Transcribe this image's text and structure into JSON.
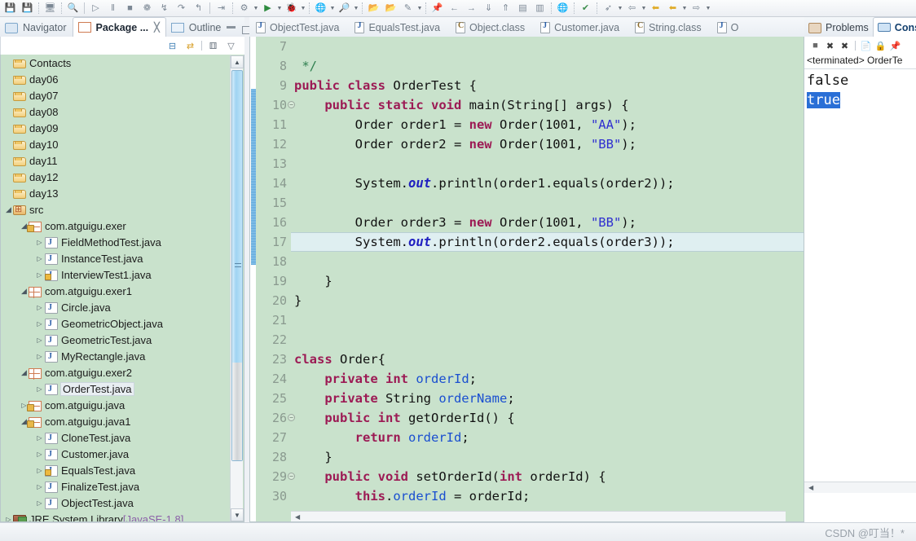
{
  "toolbar": {
    "icons": [
      {
        "name": "save-icon",
        "glyph": "💾"
      },
      {
        "name": "save-all-icon",
        "glyph": "💾"
      },
      {
        "name": "print-icon",
        "glyph": "🖵"
      },
      {
        "name": "search-icon",
        "glyph": "🔍"
      },
      {
        "name": "run-last-tool-icon",
        "glyph": "▷"
      },
      {
        "name": "pause-icon",
        "glyph": "‖"
      },
      {
        "name": "terminate-icon",
        "glyph": "■"
      },
      {
        "name": "disconnect-icon",
        "glyph": "✁"
      },
      {
        "name": "step-into-icon",
        "glyph": "↓"
      },
      {
        "name": "step-over-icon",
        "glyph": "↷"
      },
      {
        "name": "step-return-icon",
        "glyph": "↰"
      },
      {
        "name": "skip-breakpoints-icon",
        "glyph": "⇥"
      },
      {
        "name": "new-java-project-icon",
        "glyph": "⚙"
      },
      {
        "name": "run-icon",
        "glyph": "▶"
      },
      {
        "name": "debug-icon",
        "glyph": "🐞"
      },
      {
        "name": "run-external-tools-icon",
        "glyph": "🌐"
      },
      {
        "name": "search-java-icon",
        "glyph": "🔎"
      },
      {
        "name": "open-type-icon",
        "glyph": "📂"
      },
      {
        "name": "open-task-icon",
        "glyph": "📂"
      },
      {
        "name": "new-editor-icon",
        "glyph": "✎"
      },
      {
        "name": "pin-editor-icon",
        "glyph": "📌"
      },
      {
        "name": "back-icon",
        "glyph": "←"
      },
      {
        "name": "forward-icon",
        "glyph": "→"
      },
      {
        "name": "next-annotation-icon",
        "glyph": "⤓"
      },
      {
        "name": "prev-annotation-icon",
        "glyph": "⤒"
      },
      {
        "name": "toggle-mark-icon",
        "glyph": "▤"
      },
      {
        "name": "toggle-block-icon",
        "glyph": "▥"
      },
      {
        "name": "open-perspective-icon",
        "glyph": "🌐"
      },
      {
        "name": "show-view-icon",
        "glyph": "✔"
      },
      {
        "name": "last-edit-icon",
        "glyph": "➦"
      },
      {
        "name": "back-history-icon",
        "glyph": "⇦"
      },
      {
        "name": "forward-history-icon",
        "glyph": "⇨"
      },
      {
        "name": "next-nav-icon",
        "glyph": "⇨"
      }
    ]
  },
  "left_pane": {
    "tabs": [
      {
        "label": "Navigator",
        "active": false,
        "icon": "navigator-icon"
      },
      {
        "label": "Package ...",
        "active": true,
        "icon": "package-explorer-icon",
        "close": "╳"
      },
      {
        "label": "Outline",
        "active": false,
        "icon": "outline-icon"
      }
    ],
    "view_buttons": [
      {
        "name": "minimize-view-button",
        "glyph": "▁"
      },
      {
        "name": "maximize-view-button",
        "glyph": "□"
      }
    ],
    "local_toolbar": [
      {
        "name": "collapse-all-icon",
        "glyph": "⊟"
      },
      {
        "name": "link-with-editor-icon",
        "glyph": "⇄"
      },
      {
        "name": "view-menu-icon",
        "glyph": "▽"
      }
    ],
    "tree": [
      {
        "label": "Contacts",
        "indent": 0,
        "arrow": "none",
        "icon": "ic-folder",
        "selected": false
      },
      {
        "label": "day06",
        "indent": 0,
        "arrow": "none",
        "icon": "ic-folder",
        "selected": false
      },
      {
        "label": "day07",
        "indent": 0,
        "arrow": "none",
        "icon": "ic-folder",
        "selected": false
      },
      {
        "label": "day08",
        "indent": 0,
        "arrow": "none",
        "icon": "ic-folder",
        "selected": false
      },
      {
        "label": "day09",
        "indent": 0,
        "arrow": "none",
        "icon": "ic-folder",
        "selected": false
      },
      {
        "label": "day10",
        "indent": 0,
        "arrow": "none",
        "icon": "ic-folder",
        "selected": false
      },
      {
        "label": "day11",
        "indent": 0,
        "arrow": "none",
        "icon": "ic-folder",
        "selected": false
      },
      {
        "label": "day12",
        "indent": 0,
        "arrow": "none",
        "icon": "ic-folder",
        "selected": false
      },
      {
        "label": "day13",
        "indent": 0,
        "arrow": "none",
        "icon": "ic-folder",
        "selected": false
      },
      {
        "label": "src",
        "indent": 0,
        "arrow": "open",
        "icon": "ic-src",
        "selected": false
      },
      {
        "label": "com.atguigu.exer",
        "indent": 1,
        "arrow": "open",
        "icon": "ic-pkgl",
        "selected": false
      },
      {
        "label": "FieldMethodTest.java",
        "indent": 2,
        "arrow": "closed",
        "icon": "ic-java",
        "selected": false
      },
      {
        "label": "InstanceTest.java",
        "indent": 2,
        "arrow": "closed",
        "icon": "ic-java",
        "selected": false
      },
      {
        "label": "InterviewTest1.java",
        "indent": 2,
        "arrow": "closed",
        "icon": "ic-javal",
        "selected": false
      },
      {
        "label": "com.atguigu.exer1",
        "indent": 1,
        "arrow": "open",
        "icon": "ic-pkg",
        "selected": false
      },
      {
        "label": "Circle.java",
        "indent": 2,
        "arrow": "closed",
        "icon": "ic-java",
        "selected": false
      },
      {
        "label": "GeometricObject.java",
        "indent": 2,
        "arrow": "closed",
        "icon": "ic-java",
        "selected": false
      },
      {
        "label": "GeometricTest.java",
        "indent": 2,
        "arrow": "closed",
        "icon": "ic-java",
        "selected": false
      },
      {
        "label": "MyRectangle.java",
        "indent": 2,
        "arrow": "closed",
        "icon": "ic-java",
        "selected": false
      },
      {
        "label": "com.atguigu.exer2",
        "indent": 1,
        "arrow": "open",
        "icon": "ic-pkg",
        "selected": false
      },
      {
        "label": "OrderTest.java",
        "indent": 2,
        "arrow": "closed",
        "icon": "ic-java",
        "selected": true
      },
      {
        "label": "com.atguigu.java",
        "indent": 1,
        "arrow": "closed",
        "icon": "ic-pkgl",
        "selected": false
      },
      {
        "label": "com.atguigu.java1",
        "indent": 1,
        "arrow": "open",
        "icon": "ic-pkgl",
        "selected": false
      },
      {
        "label": "CloneTest.java",
        "indent": 2,
        "arrow": "closed",
        "icon": "ic-java",
        "selected": false
      },
      {
        "label": "Customer.java",
        "indent": 2,
        "arrow": "closed",
        "icon": "ic-java",
        "selected": false
      },
      {
        "label": "EqualsTest.java",
        "indent": 2,
        "arrow": "closed",
        "icon": "ic-javal",
        "selected": false
      },
      {
        "label": "FinalizeTest.java",
        "indent": 2,
        "arrow": "closed",
        "icon": "ic-java",
        "selected": false
      },
      {
        "label": "ObjectTest.java",
        "indent": 2,
        "arrow": "closed",
        "icon": "ic-java",
        "selected": false
      },
      {
        "label": "JRE System Library",
        "indent": 0,
        "arrow": "closed",
        "icon": "ic-jre",
        "selected": false,
        "suffix": " [JavaSE-1.8]"
      }
    ]
  },
  "editor": {
    "tabs": [
      {
        "label": "ObjectTest.java",
        "icon": "java-file-icon"
      },
      {
        "label": "EqualsTest.java",
        "icon": "java-file-lock-icon"
      },
      {
        "label": "Object.class",
        "icon": "class-file-icon"
      },
      {
        "label": "Customer.java",
        "icon": "java-file-icon"
      },
      {
        "label": "String.class",
        "icon": "class-file-icon"
      },
      {
        "label": "O",
        "icon": "java-file-icon"
      }
    ],
    "first_line_number": 7,
    "highlighted_line": 17,
    "fold_lines": [
      10,
      26,
      29
    ],
    "lines": [
      {
        "n": 7,
        "tokens": []
      },
      {
        "n": 8,
        "tokens": [
          {
            "t": " */",
            "c": "cmt"
          }
        ]
      },
      {
        "n": 9,
        "tokens": [
          {
            "t": "public",
            "c": "kw"
          },
          {
            "t": " ",
            "c": "plain"
          },
          {
            "t": "class",
            "c": "kw"
          },
          {
            "t": " OrderTest {",
            "c": "plain"
          }
        ]
      },
      {
        "n": 10,
        "tokens": [
          {
            "t": "    ",
            "c": "plain"
          },
          {
            "t": "public",
            "c": "kw"
          },
          {
            "t": " ",
            "c": "plain"
          },
          {
            "t": "static",
            "c": "kw"
          },
          {
            "t": " ",
            "c": "plain"
          },
          {
            "t": "void",
            "c": "kw"
          },
          {
            "t": " main(String[] args) {",
            "c": "plain"
          }
        ]
      },
      {
        "n": 11,
        "tokens": [
          {
            "t": "        Order order1 = ",
            "c": "plain"
          },
          {
            "t": "new",
            "c": "kw"
          },
          {
            "t": " Order(1001, ",
            "c": "plain"
          },
          {
            "t": "\"AA\"",
            "c": "str"
          },
          {
            "t": ");",
            "c": "plain"
          }
        ]
      },
      {
        "n": 12,
        "tokens": [
          {
            "t": "        Order order2 = ",
            "c": "plain"
          },
          {
            "t": "new",
            "c": "kw"
          },
          {
            "t": " Order(1001, ",
            "c": "plain"
          },
          {
            "t": "\"BB\"",
            "c": "str"
          },
          {
            "t": ");",
            "c": "plain"
          }
        ]
      },
      {
        "n": 13,
        "tokens": []
      },
      {
        "n": 14,
        "tokens": [
          {
            "t": "        System.",
            "c": "plain"
          },
          {
            "t": "out",
            "c": "stat"
          },
          {
            "t": ".println(order1.equals(order2));",
            "c": "plain"
          }
        ]
      },
      {
        "n": 15,
        "tokens": []
      },
      {
        "n": 16,
        "tokens": [
          {
            "t": "        Order order3 = ",
            "c": "plain"
          },
          {
            "t": "new",
            "c": "kw"
          },
          {
            "t": " Order(1001, ",
            "c": "plain"
          },
          {
            "t": "\"BB\"",
            "c": "str"
          },
          {
            "t": ");",
            "c": "plain"
          }
        ]
      },
      {
        "n": 17,
        "tokens": [
          {
            "t": "        System.",
            "c": "plain"
          },
          {
            "t": "out",
            "c": "stat"
          },
          {
            "t": ".println(order2.equals(order3));",
            "c": "plain"
          }
        ]
      },
      {
        "n": 18,
        "tokens": []
      },
      {
        "n": 19,
        "tokens": [
          {
            "t": "    }",
            "c": "plain"
          }
        ]
      },
      {
        "n": 20,
        "tokens": [
          {
            "t": "}",
            "c": "plain"
          }
        ]
      },
      {
        "n": 21,
        "tokens": []
      },
      {
        "n": 22,
        "tokens": []
      },
      {
        "n": 23,
        "tokens": [
          {
            "t": "class",
            "c": "kw"
          },
          {
            "t": " Order{",
            "c": "plain"
          }
        ]
      },
      {
        "n": 24,
        "tokens": [
          {
            "t": "    ",
            "c": "plain"
          },
          {
            "t": "private",
            "c": "kw"
          },
          {
            "t": " ",
            "c": "plain"
          },
          {
            "t": "int",
            "c": "kw"
          },
          {
            "t": " ",
            "c": "plain"
          },
          {
            "t": "orderId",
            "c": "fld"
          },
          {
            "t": ";",
            "c": "plain"
          }
        ]
      },
      {
        "n": 25,
        "tokens": [
          {
            "t": "    ",
            "c": "plain"
          },
          {
            "t": "private",
            "c": "kw"
          },
          {
            "t": " String ",
            "c": "plain"
          },
          {
            "t": "orderName",
            "c": "fld"
          },
          {
            "t": ";",
            "c": "plain"
          }
        ]
      },
      {
        "n": 26,
        "tokens": [
          {
            "t": "    ",
            "c": "plain"
          },
          {
            "t": "public",
            "c": "kw"
          },
          {
            "t": " ",
            "c": "plain"
          },
          {
            "t": "int",
            "c": "kw"
          },
          {
            "t": " getOrderId() {",
            "c": "plain"
          }
        ]
      },
      {
        "n": 27,
        "tokens": [
          {
            "t": "        ",
            "c": "plain"
          },
          {
            "t": "return",
            "c": "kw"
          },
          {
            "t": " ",
            "c": "plain"
          },
          {
            "t": "orderId",
            "c": "fld"
          },
          {
            "t": ";",
            "c": "plain"
          }
        ]
      },
      {
        "n": 28,
        "tokens": [
          {
            "t": "    }",
            "c": "plain"
          }
        ]
      },
      {
        "n": 29,
        "tokens": [
          {
            "t": "    ",
            "c": "plain"
          },
          {
            "t": "public",
            "c": "kw"
          },
          {
            "t": " ",
            "c": "plain"
          },
          {
            "t": "void",
            "c": "kw"
          },
          {
            "t": " setOrderId(",
            "c": "plain"
          },
          {
            "t": "int",
            "c": "kw"
          },
          {
            "t": " orderId) {",
            "c": "plain"
          }
        ]
      },
      {
        "n": 30,
        "tokens": [
          {
            "t": "        ",
            "c": "plain"
          },
          {
            "t": "this",
            "c": "kw"
          },
          {
            "t": ".",
            "c": "plain"
          },
          {
            "t": "orderId",
            "c": "fld"
          },
          {
            "t": " = orderId;",
            "c": "plain"
          }
        ]
      }
    ]
  },
  "right_pane": {
    "tabs": [
      {
        "label": "Problems",
        "active": false,
        "icon": "problems-icon"
      },
      {
        "label": "Cons",
        "active": true,
        "icon": "console-icon"
      }
    ],
    "local_toolbar": [
      {
        "name": "terminate-icon",
        "glyph": "■"
      },
      {
        "name": "remove-launch-icon",
        "glyph": "✖"
      },
      {
        "name": "remove-all-terminated-icon",
        "glyph": "✖"
      },
      {
        "name": "clear-console-icon",
        "glyph": "📄"
      },
      {
        "name": "scroll-lock-icon",
        "glyph": "🔒"
      },
      {
        "name": "pin-console-icon",
        "glyph": "📌"
      }
    ],
    "status_line": "<terminated> OrderTe",
    "output": [
      {
        "text": "false",
        "selected": false
      },
      {
        "text": "true",
        "selected": true
      }
    ]
  },
  "status_bar": {
    "watermark": "CSDN @叮当！*"
  },
  "colors": {
    "editor_background": "#c9e2cc",
    "tree_background": "#c9e2cc",
    "keyword": "#9c1a54",
    "string": "#2f2fd0",
    "field": "#1a4fd0",
    "comment": "#2f7f4f",
    "selection": "#2a6fd6",
    "change_bar": "#5fa8de"
  }
}
